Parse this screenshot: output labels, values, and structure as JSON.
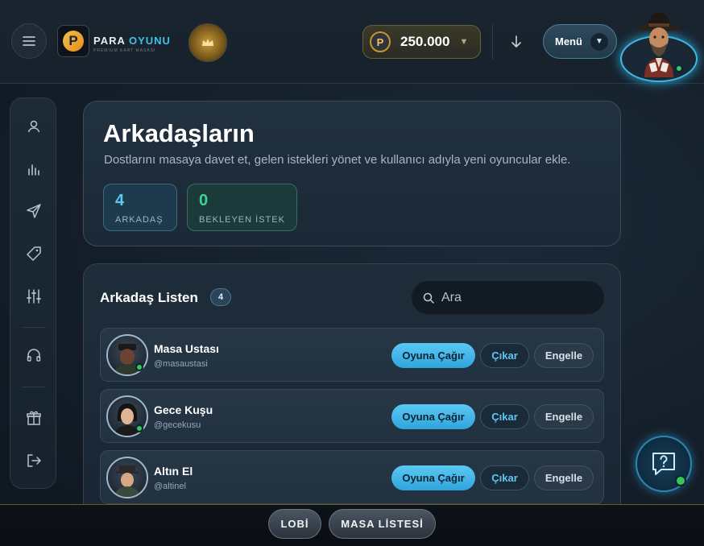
{
  "header": {
    "logo_letter": "P",
    "logo_word1": "PARA",
    "logo_word2": "OYUNU",
    "logo_tagline": "PREMIUM KART MASASI",
    "coin_letter": "P",
    "balance": "250.000",
    "menu_label": "Menü"
  },
  "hero": {
    "title": "Arkadaşların",
    "subtitle": "Dostlarını masaya davet et, gelen istekleri yönet ve kullanıcı adıyla yeni oyuncular ekle.",
    "stats": [
      {
        "value": "4",
        "label": "ARKADAŞ"
      },
      {
        "value": "0",
        "label": "BEKLEYEN İSTEK"
      }
    ]
  },
  "friends": {
    "title": "Arkadaş Listen",
    "count": "4",
    "search_placeholder": "Ara",
    "items": [
      {
        "name": "Masa Ustası",
        "handle": "@masaustasi",
        "invite": "Oyuna Çağır",
        "remove": "Çıkar",
        "block": "Engelle"
      },
      {
        "name": "Gece Kuşu",
        "handle": "@gecekusu",
        "invite": "Oyuna Çağır",
        "remove": "Çıkar",
        "block": "Engelle"
      },
      {
        "name": "Altın El",
        "handle": "@altinel",
        "invite": "Oyuna Çağır",
        "remove": "Çıkar",
        "block": "Engelle"
      }
    ]
  },
  "bottom_nav": {
    "lobby": "LOBİ",
    "tables": "MASA LİSTESİ"
  },
  "colors": {
    "accent": "#3fb7e3",
    "online": "#32c85a",
    "gold": "#c4962c"
  }
}
